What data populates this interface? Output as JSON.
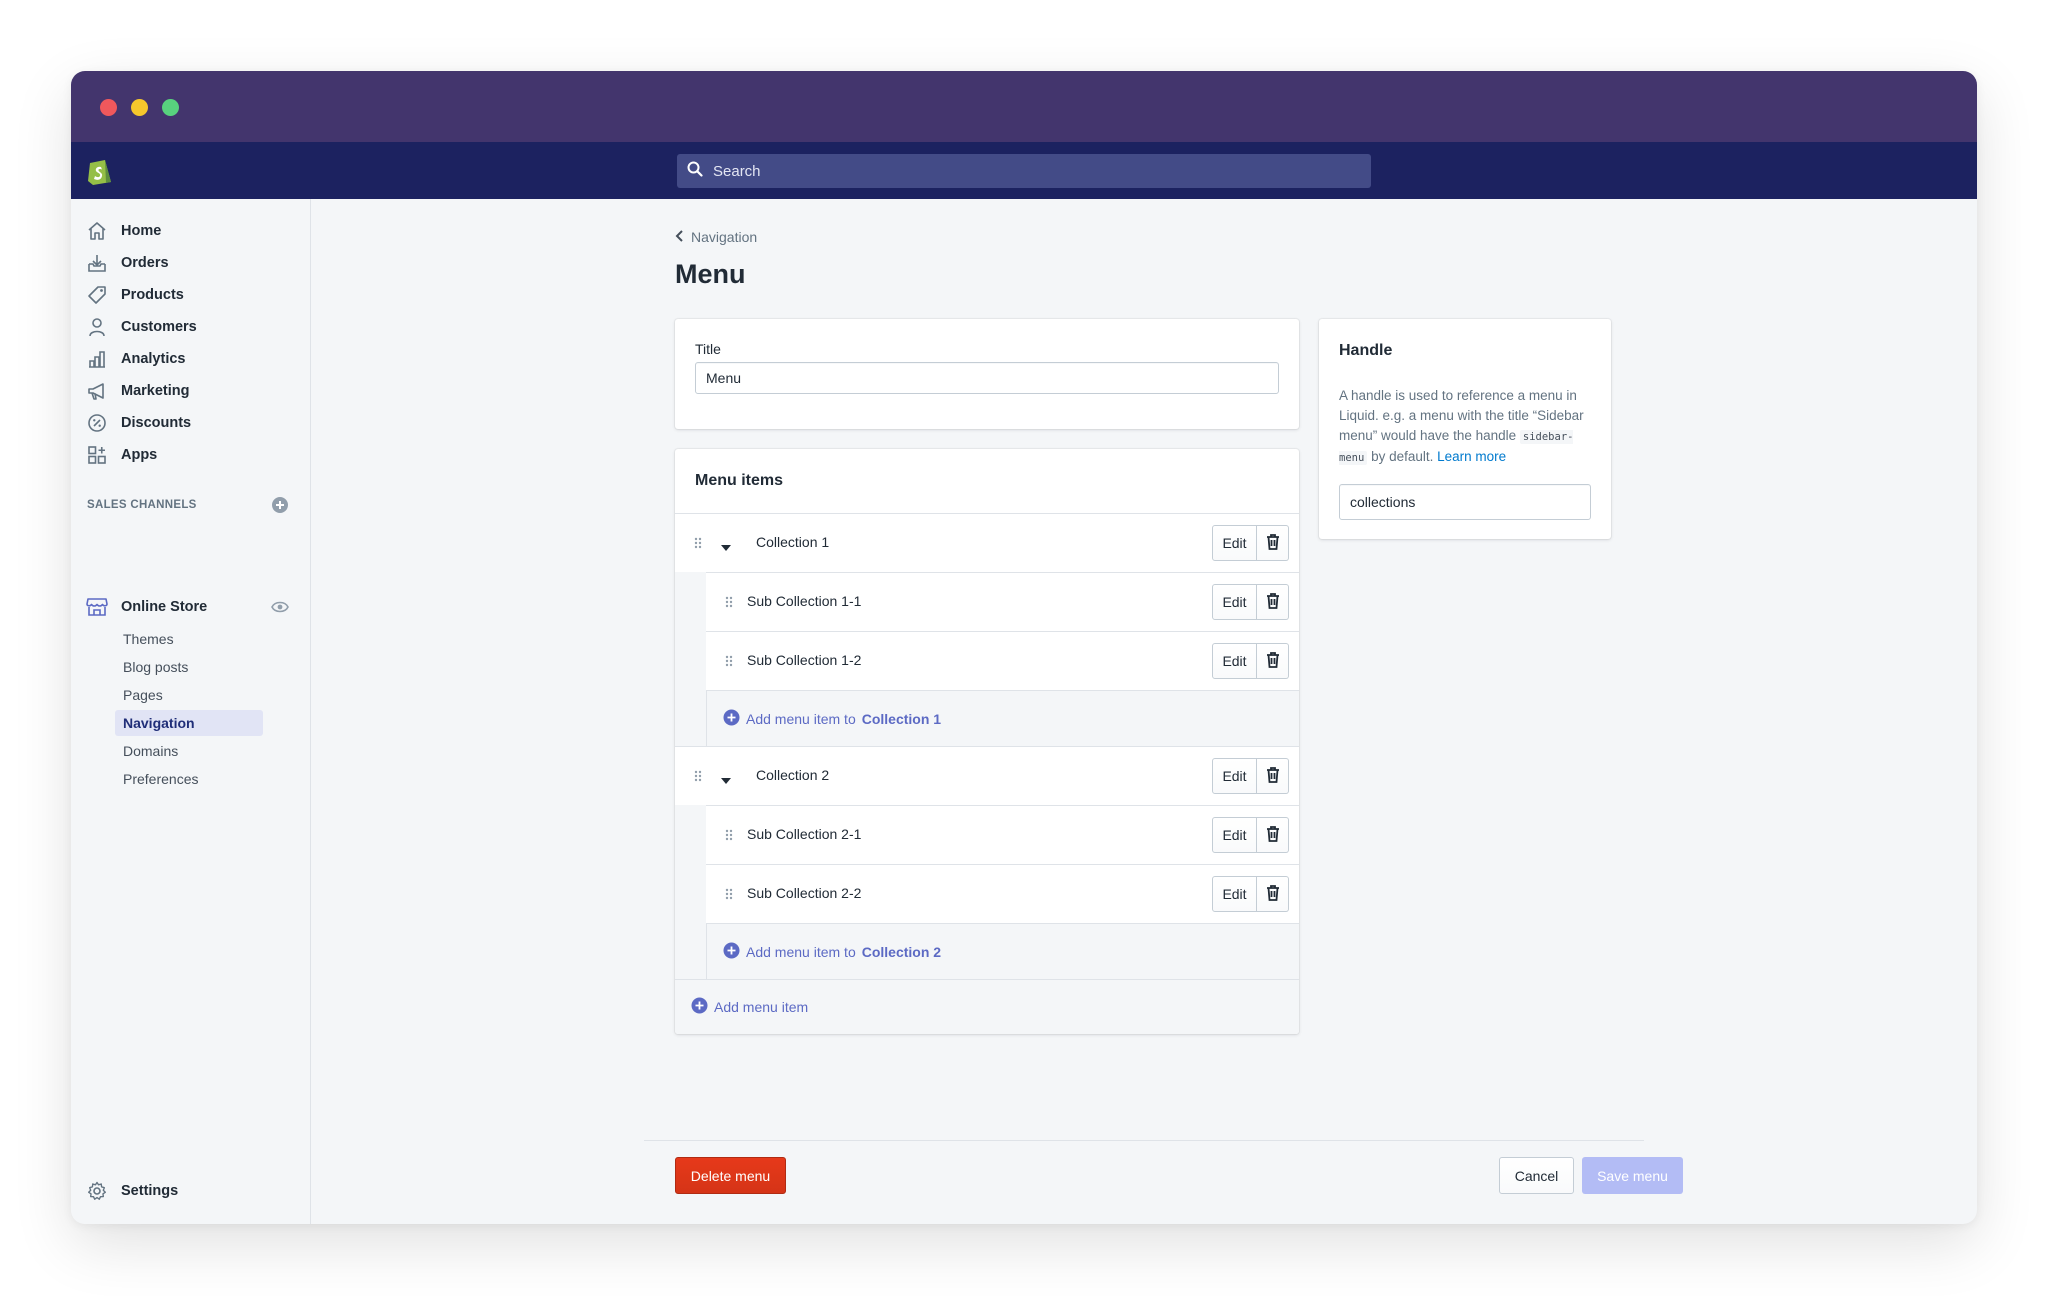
{
  "search": {
    "placeholder": "Search"
  },
  "sidebar": {
    "items": [
      {
        "label": "Home",
        "icon": "home-icon"
      },
      {
        "label": "Orders",
        "icon": "orders-icon"
      },
      {
        "label": "Products",
        "icon": "tag-icon"
      },
      {
        "label": "Customers",
        "icon": "person-icon"
      },
      {
        "label": "Analytics",
        "icon": "bar-chart-icon"
      },
      {
        "label": "Marketing",
        "icon": "megaphone-icon"
      },
      {
        "label": "Discounts",
        "icon": "discount-icon"
      },
      {
        "label": "Apps",
        "icon": "apps-icon"
      }
    ],
    "sales_channels_label": "SALES CHANNELS",
    "online_store_label": "Online Store",
    "online_store_sub": [
      "Themes",
      "Blog posts",
      "Pages",
      "Navigation",
      "Domains",
      "Preferences"
    ],
    "active_sub": "Navigation",
    "settings_label": "Settings"
  },
  "page": {
    "breadcrumb": "Navigation",
    "title": "Menu"
  },
  "title_card": {
    "label": "Title",
    "value": "Menu"
  },
  "menu_items": {
    "heading": "Menu items",
    "edit_label": "Edit",
    "groups": [
      {
        "label": "Collection 1",
        "children": [
          "Sub Collection 1-1",
          "Sub Collection 1-2"
        ],
        "add_prefix": "Add menu item to",
        "add_target": "Collection 1"
      },
      {
        "label": "Collection 2",
        "children": [
          "Sub Collection 2-1",
          "Sub Collection 2-2"
        ],
        "add_prefix": "Add menu item to",
        "add_target": "Collection 2"
      }
    ],
    "add_item_label": "Add menu item"
  },
  "handle_card": {
    "heading": "Handle",
    "help_text_1": "A handle is used to reference a menu in Liquid. e.g. a menu with the title “Sidebar menu” would have the handle",
    "help_code": "sidebar-menu",
    "help_text_2": "by default.",
    "learn_more": "Learn more",
    "value": "collections"
  },
  "footer": {
    "delete_label": "Delete menu",
    "cancel_label": "Cancel",
    "save_label": "Save menu"
  },
  "colors": {
    "titlebar": "#43356d",
    "topbar": "#1c2260",
    "accent": "#5c6ac4",
    "danger": "#de3618",
    "save_disabled": "#b3bcf5"
  }
}
